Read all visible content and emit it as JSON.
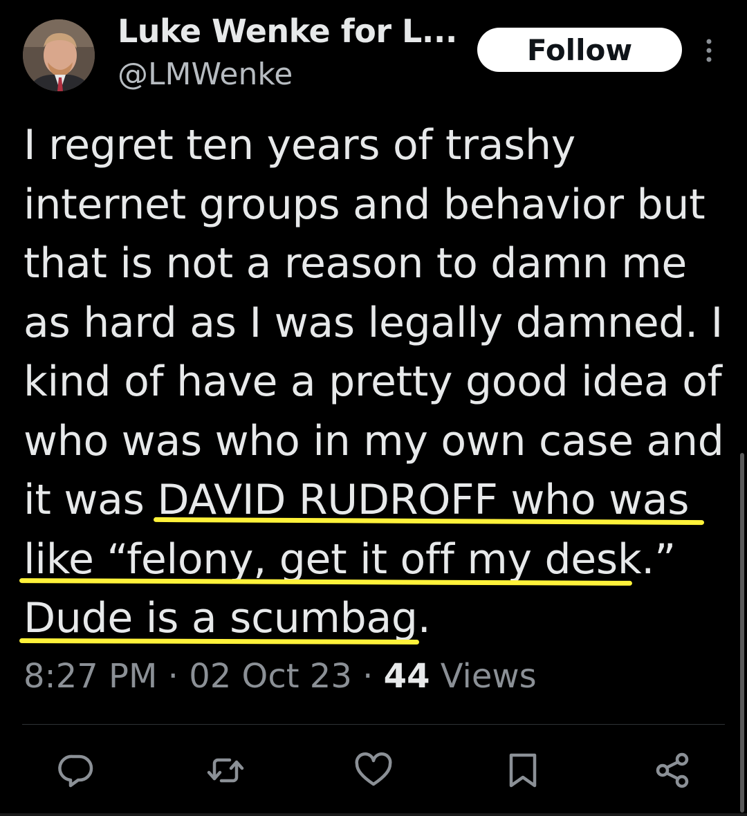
{
  "author": {
    "name": "Luke Wenke for L...",
    "handle": "@LMWenke",
    "avatar_icon": "user-photo"
  },
  "follow_label": "Follow",
  "tweet": {
    "lines": [
      "I regret ten years of trashy",
      "internet groups and behavior but",
      "that is not a reason to damn me",
      "as hard as I was legally damned.  I",
      "kind of have a pretty good idea of",
      "who was who in my own case and",
      "it was DAVID RUDROFF who was",
      "like “felony, get it off my desk.”",
      "Dude is a scumbag."
    ],
    "highlight_color": "#fff23a"
  },
  "meta": {
    "time": "8:27 PM",
    "separator": "·",
    "date": "02 Oct 23",
    "views_count": "44",
    "views_label": "Views"
  },
  "actions": [
    {
      "name": "reply",
      "icon": "reply-icon"
    },
    {
      "name": "retweet",
      "icon": "retweet-icon"
    },
    {
      "name": "like",
      "icon": "heart-icon"
    },
    {
      "name": "bookmark",
      "icon": "bookmark-icon"
    },
    {
      "name": "share",
      "icon": "share-icon"
    }
  ],
  "colors": {
    "background": "#000000",
    "text": "#e7e9ea",
    "secondary": "#8b9096",
    "icon": "#8b9096"
  }
}
